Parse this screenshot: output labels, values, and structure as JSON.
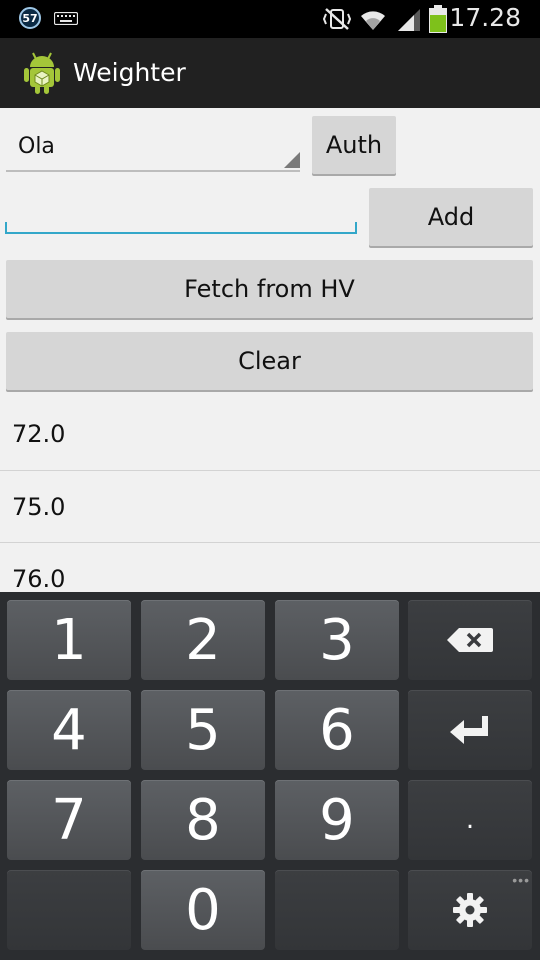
{
  "status_bar": {
    "notification_count": "57",
    "time": "17.28",
    "icons": [
      "keyboard-icon",
      "mute-vibrate-icon",
      "wifi-icon",
      "signal-icon",
      "battery-icon"
    ],
    "colors": {
      "battery": "#7ec11b",
      "badge_ring": "#9ec7e6"
    }
  },
  "action_bar": {
    "app_icon": "android-app-icon",
    "title": "Weighter"
  },
  "form": {
    "spinner_value": "Ola",
    "auth_label": "Auth",
    "weight_input_value": "",
    "add_label": "Add",
    "fetch_label": "Fetch from HV",
    "clear_label": "Clear",
    "accent_color": "#33a7c9"
  },
  "weights": [
    "72.0",
    "75.0",
    "76.0"
  ],
  "keyboard": {
    "rows": [
      [
        "1",
        "2",
        "3",
        "backspace-icon"
      ],
      [
        "4",
        "5",
        "6",
        "enter-icon"
      ],
      [
        "7",
        "8",
        "9",
        "."
      ],
      [
        "",
        "0",
        "",
        "settings-icon"
      ]
    ],
    "more": "•••"
  }
}
